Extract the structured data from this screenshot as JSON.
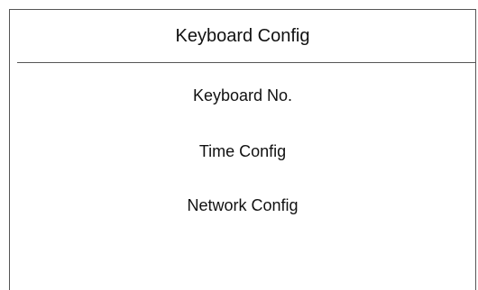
{
  "title": "Keyboard Config",
  "menu": {
    "items": [
      {
        "label": "Keyboard No."
      },
      {
        "label": "Time Config"
      },
      {
        "label": "Network Config"
      }
    ]
  }
}
